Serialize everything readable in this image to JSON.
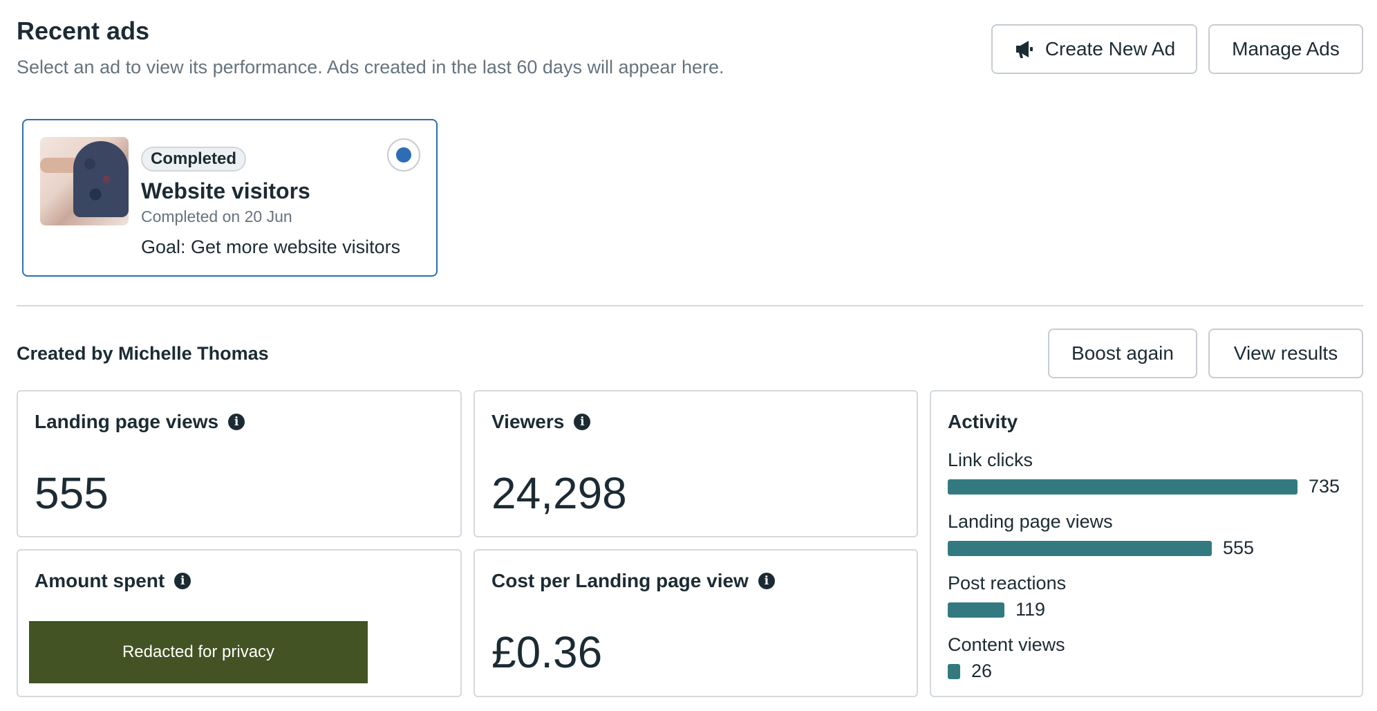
{
  "header": {
    "title": "Recent ads",
    "subtitle": "Select an ad to view its performance. Ads created in the last 60 days will appear here.",
    "create_label": "Create New Ad",
    "manage_label": "Manage Ads",
    "create_icon": "megaphone-icon"
  },
  "ad": {
    "badge": "Completed",
    "title": "Website visitors",
    "date": "Completed on 20 Jun",
    "goal": "Goal: Get more website visitors",
    "selected": true,
    "accent": "#2d6db5"
  },
  "summary": {
    "created_by": "Created by Michelle Thomas",
    "boost_label": "Boost again",
    "results_label": "View results"
  },
  "metrics": {
    "landing_page_views": {
      "label": "Landing page views",
      "value": "555"
    },
    "viewers": {
      "label": "Viewers",
      "value": "24,298"
    },
    "amount_spent": {
      "label": "Amount spent",
      "redacted": "Redacted for privacy"
    },
    "cost_per_lpv": {
      "label": "Cost per Landing page view",
      "value": "£0.36"
    }
  },
  "activity": {
    "title": "Activity",
    "bar_color": "#337a80",
    "max": 735,
    "rows": [
      {
        "label": "Link clicks",
        "value": 735,
        "display": "735"
      },
      {
        "label": "Landing page views",
        "value": 555,
        "display": "555"
      },
      {
        "label": "Post reactions",
        "value": 119,
        "display": "119"
      },
      {
        "label": "Content views",
        "value": 26,
        "display": "26"
      }
    ]
  }
}
